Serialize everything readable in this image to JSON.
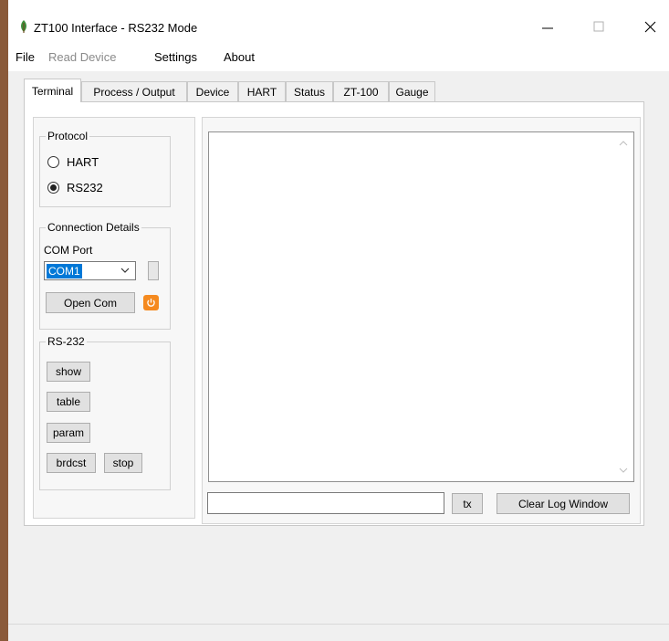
{
  "window": {
    "title": "ZT100 Interface - RS232 Mode",
    "minimize_glyph": "—",
    "maximize_glyph": "☐",
    "close_glyph": "✕"
  },
  "menu": {
    "items": [
      {
        "label": "File",
        "enabled": true
      },
      {
        "label": "Read Device",
        "enabled": false
      },
      {
        "label": "Settings",
        "enabled": true
      },
      {
        "label": "About",
        "enabled": true
      }
    ]
  },
  "tabs": [
    {
      "label": "Terminal",
      "active": true
    },
    {
      "label": "Process / Output",
      "active": false
    },
    {
      "label": "Device",
      "active": false
    },
    {
      "label": "HART",
      "active": false
    },
    {
      "label": "Status",
      "active": false
    },
    {
      "label": "ZT-100",
      "active": false
    },
    {
      "label": "Gauge",
      "active": false
    }
  ],
  "protocol": {
    "label": "Protocol",
    "options": [
      {
        "label": "HART",
        "checked": false
      },
      {
        "label": "RS232",
        "checked": true
      }
    ]
  },
  "connection": {
    "label": "Connection Details",
    "com_port_label": "COM Port",
    "com_port_value": "COM1",
    "open_button": "Open Com"
  },
  "rs232": {
    "label": "RS-232",
    "buttons": {
      "show": "show",
      "table": "table",
      "param": "param",
      "brdcst": "brdcst",
      "stop": "stop"
    }
  },
  "log": {
    "input_value": "",
    "tx_button": "tx",
    "clear_button": "Clear Log Window"
  },
  "colors": {
    "power_button": "#f58a1f",
    "selection": "#0078d7",
    "app_icon": "#3c8f3c"
  }
}
